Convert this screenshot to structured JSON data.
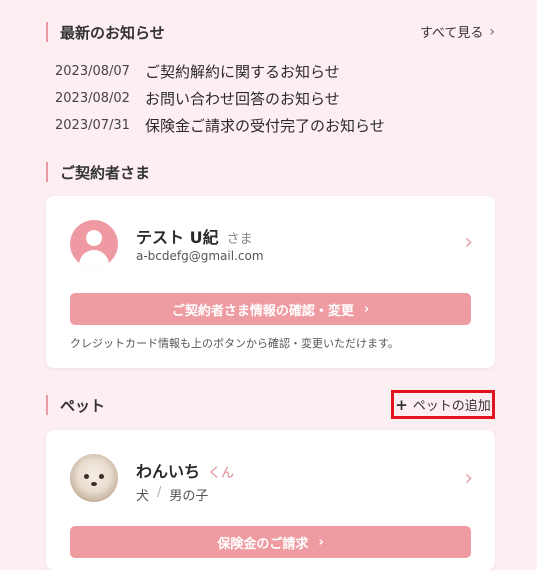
{
  "news": {
    "section_title": "最新のお知らせ",
    "see_all": "すべて見る",
    "items": [
      {
        "date": "2023/08/07",
        "title": "ご契約解約に関するお知らせ"
      },
      {
        "date": "2023/08/02",
        "title": "お問い合わせ回答のお知らせ"
      },
      {
        "date": "2023/07/31",
        "title": "保険金ご請求の受付完了のお知らせ"
      }
    ]
  },
  "contractor": {
    "section_title": "ご契約者さま",
    "name": "テスト U紀",
    "honorific": "さま",
    "email": "a-bcdefg@gmail.com",
    "confirm_button": "ご契約者さま情報の確認・変更",
    "note": "クレジットカード情報も上のボタンから確認・変更いただけます。"
  },
  "pets": {
    "section_title": "ペット",
    "add_button": "ペットの追加",
    "items": [
      {
        "name": "わんいち",
        "honorific": "くん",
        "species": "犬",
        "separator": "/",
        "gender": "男の子",
        "claim_button": "保険金のご請求"
      }
    ]
  },
  "icons": {
    "chevron": "chevron-right-icon",
    "plus": "plus-icon",
    "user": "user-icon"
  },
  "colors": {
    "accent": "#ef9ba2",
    "background": "#fdeef1",
    "highlight": "#e0141e"
  }
}
